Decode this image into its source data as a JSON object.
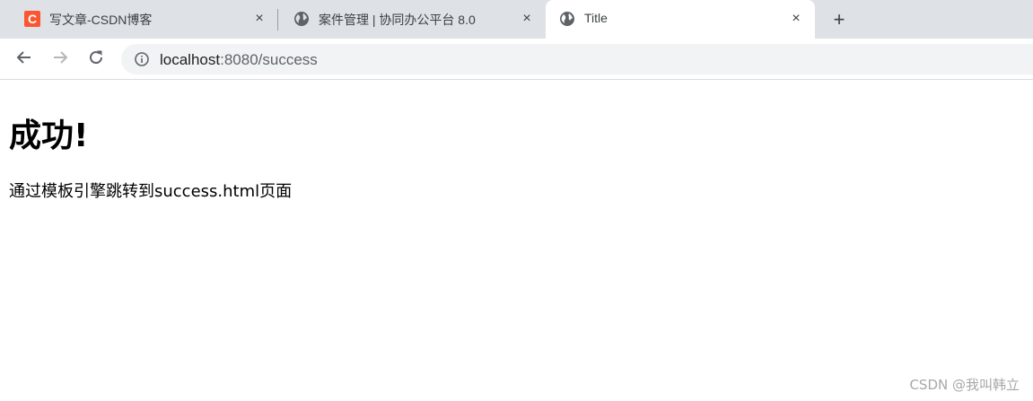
{
  "browser": {
    "tabs": [
      {
        "title": "写文章-CSDN博客",
        "icon": "csdn-logo-icon",
        "icon_letter": "C",
        "icon_color": "#fc5531",
        "close": "×"
      },
      {
        "title": "案件管理 | 协同办公平台 8.0",
        "icon": "globe-icon",
        "close": "×"
      },
      {
        "title": "Title",
        "icon": "globe-icon",
        "close": "×",
        "active": true
      }
    ],
    "new_tab_label": "+",
    "address": {
      "host": "localhost",
      "rest": ":8080/success"
    }
  },
  "page": {
    "heading": "成功!",
    "text": "通过模板引擎跳转到success.html页面"
  },
  "watermark": "CSDN @我叫韩立",
  "colors": {
    "tabstrip": "#dee1e6",
    "active_tab": "#ffffff",
    "omnibox": "#f1f3f4",
    "watermark": "#a8a8a8"
  }
}
